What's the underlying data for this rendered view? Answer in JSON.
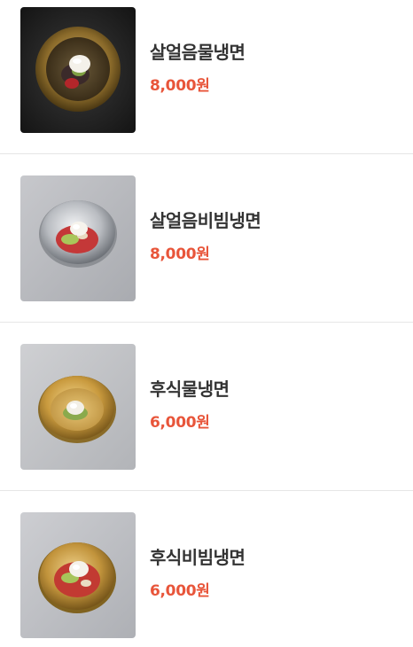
{
  "menu": {
    "items": [
      {
        "name": "살얼음물냉면",
        "price": "8,000원",
        "photo": "naengmyeon-photo"
      },
      {
        "name": "살얼음비빔냉면",
        "price": "8,000원",
        "photo": "bibim-naengmyeon-photo"
      },
      {
        "name": "후식물냉면",
        "price": "6,000원",
        "photo": "naengmyeon-photo"
      },
      {
        "name": "후식비빔냉면",
        "price": "6,000원",
        "photo": "bibim-naengmyeon-photo"
      }
    ]
  },
  "colors": {
    "price": "#e8553a",
    "name": "#333333",
    "divider": "#e6e6e6"
  }
}
